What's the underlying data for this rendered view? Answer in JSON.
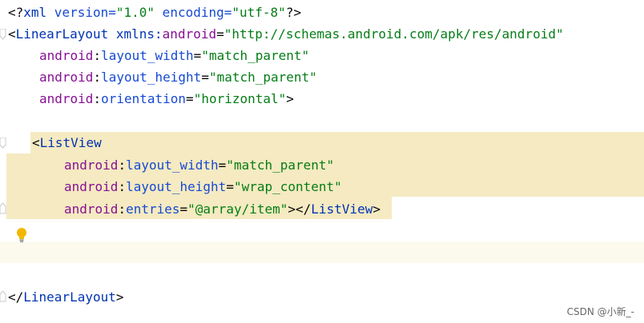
{
  "lines": {
    "l1": {
      "open": "<?",
      "name": "xml",
      "a1": " version=",
      "v1": "\"1.0\"",
      "a2": " encoding=",
      "v2": "\"utf-8\"",
      "close": "?>"
    },
    "l2": {
      "open": "<",
      "name": "LinearLayout",
      "a1": " xmlns:",
      "ns1": "android",
      "eq": "=",
      "v1": "\"http://schemas.android.com/apk/res/android\""
    },
    "l3": {
      "ns": "android",
      "colon": ":",
      "attr": "layout_width",
      "eq": "=",
      "val": "\"match_parent\""
    },
    "l4": {
      "ns": "android",
      "colon": ":",
      "attr": "layout_height",
      "eq": "=",
      "val": "\"match_parent\""
    },
    "l5": {
      "ns": "android",
      "colon": ":",
      "attr": "orientation",
      "eq": "=",
      "val": "\"horizontal\"",
      "close": ">"
    },
    "l7": {
      "open": "<",
      "name": "ListView"
    },
    "l8": {
      "ns": "android",
      "colon": ":",
      "attr": "layout_width",
      "eq": "=",
      "val": "\"match_parent\""
    },
    "l9": {
      "ns": "android",
      "colon": ":",
      "attr": "layout_height",
      "eq": "=",
      "val": "\"wrap_content\""
    },
    "l10": {
      "ns": "android",
      "colon": ":",
      "attr": "entries",
      "eq": "=",
      "val": "\"@array/item\"",
      "close1": "></",
      "name": "ListView",
      "close2": ">"
    },
    "l13": {
      "open": "</",
      "name": "LinearLayout",
      "close": ">"
    }
  },
  "gutter": {
    "intention_icon": "lightbulb-icon"
  },
  "watermark": "CSDN @小新_-",
  "colors": {
    "tag": "#0033b3",
    "namespace": "#871094",
    "attribute": "#174ad4",
    "value": "#067d17",
    "highlight": "#f5eac1",
    "caret_line": "#fcfaed"
  }
}
